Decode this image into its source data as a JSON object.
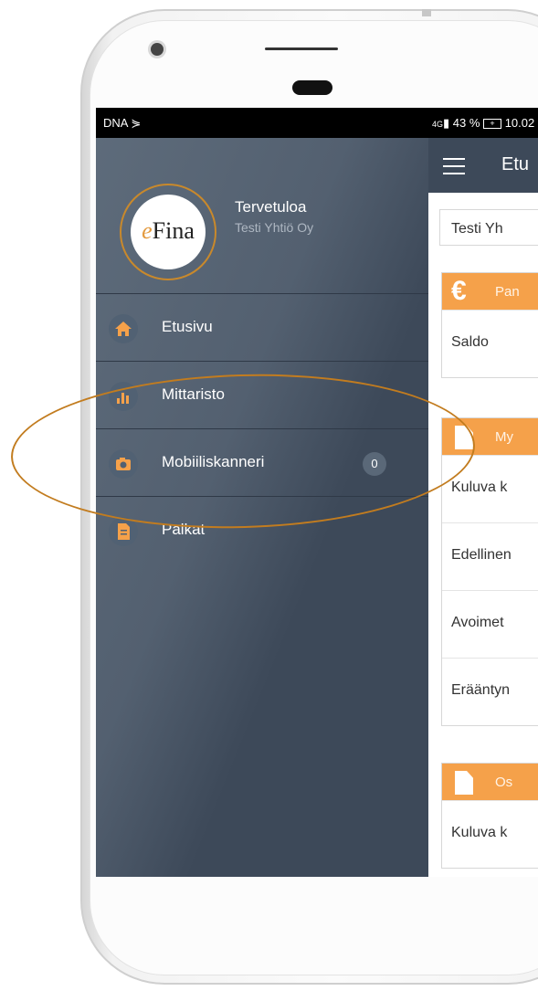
{
  "status_bar": {
    "carrier": "DNA",
    "network": "4G",
    "battery": "43 %",
    "time": "10.02"
  },
  "drawer": {
    "logo_e": "e",
    "logo_rest": "Fina",
    "welcome": "Tervetuloa",
    "company": "Testi Yhtiö Oy",
    "items": [
      {
        "label": "Etusivu",
        "icon": "home-icon"
      },
      {
        "label": "Mittaristo",
        "icon": "bar-chart-icon"
      },
      {
        "label": "Mobiiliskanneri",
        "icon": "camera-icon",
        "badge": "0"
      },
      {
        "label": "Palkat",
        "icon": "document-icon"
      }
    ]
  },
  "appbar": {
    "title": "Etu"
  },
  "content": {
    "company_select": "Testi Yh",
    "cards": [
      {
        "header": "Pan",
        "header_icon": "€",
        "rows": [
          "Saldo"
        ]
      },
      {
        "header": "My",
        "rows": [
          "Kuluva k",
          "Edellinen",
          "Avoimet",
          "Erääntyn"
        ]
      },
      {
        "header": "Os",
        "rows": [
          "Kuluva k"
        ]
      }
    ]
  },
  "colors": {
    "drawer_bg": "#3d4959",
    "accent": "#f5a14a",
    "highlight_ring": "#c27c1f"
  }
}
